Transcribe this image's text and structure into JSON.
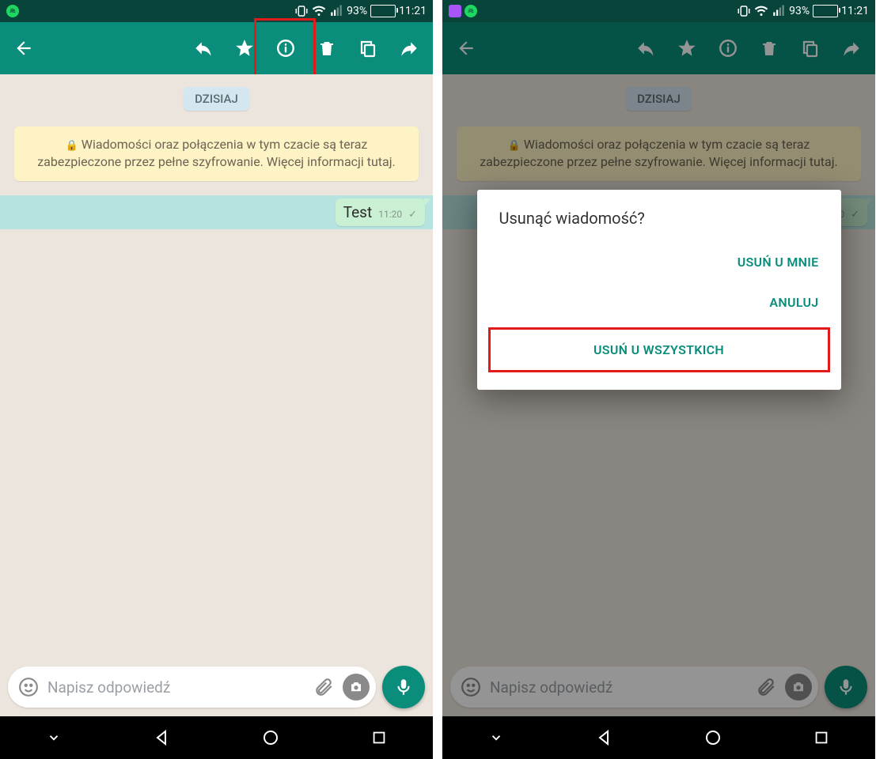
{
  "status": {
    "battery_pct": "93%",
    "time": "11:21"
  },
  "chat": {
    "date_label": "DZISIAJ",
    "encryption_text": "Wiadomości oraz połączenia w tym czacie są teraz zabezpieczone przez pełne szyfrowanie. Więcej informacji tutaj.",
    "message_text": "Test",
    "message_time": "11:20",
    "input_placeholder": "Napisz odpowiedź"
  },
  "dialog": {
    "title": "Usunąć wiadomość?",
    "delete_for_me": "USUŃ U MNIE",
    "cancel": "ANULUJ",
    "delete_for_everyone": "USUŃ U WSZYSTKICH"
  }
}
